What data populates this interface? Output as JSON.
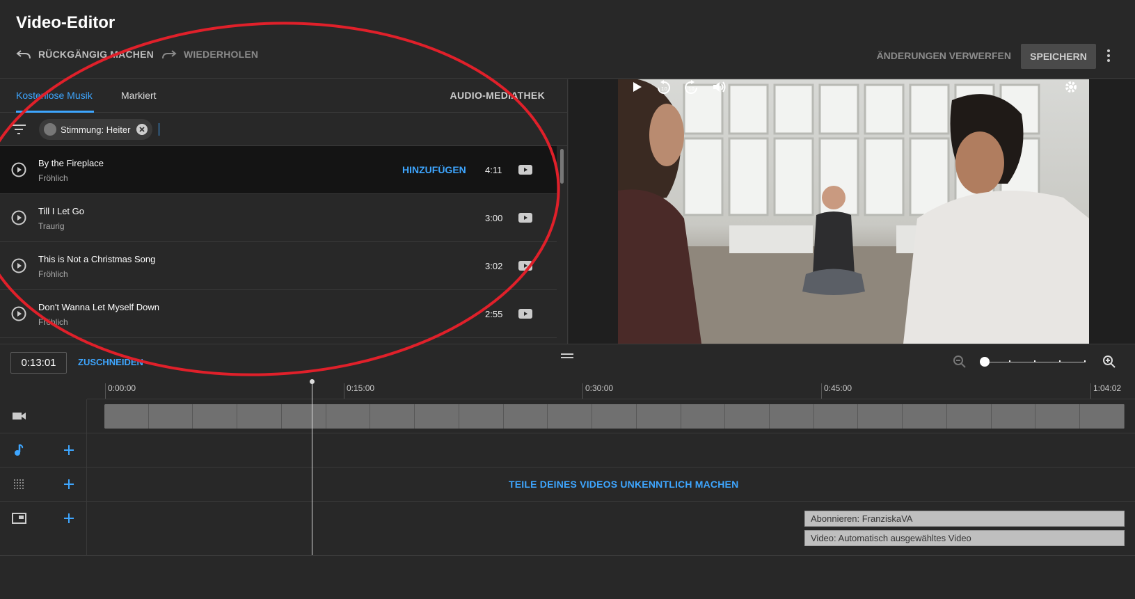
{
  "header": {
    "title": "Video-Editor",
    "undo_label": "RÜCKGÄNGIG MACHEN",
    "redo_label": "WIEDERHOLEN",
    "discard_label": "ÄNDERUNGEN VERWERFEN",
    "save_label": "SPEICHERN"
  },
  "audio_panel": {
    "tabs": [
      {
        "label": "Kostenlose Musik",
        "active": true
      },
      {
        "label": "Markiert",
        "active": false
      }
    ],
    "library_label": "AUDIO-MEDIATHEK",
    "filter_chip": "Stimmung: Heiter",
    "add_label": "HINZUFÜGEN",
    "tracks": [
      {
        "title": "By the Fireplace",
        "mood": "Fröhlich",
        "duration": "4:11"
      },
      {
        "title": "Till I Let Go",
        "mood": "Traurig",
        "duration": "3:00"
      },
      {
        "title": "This is Not a Christmas Song",
        "mood": "Fröhlich",
        "duration": "3:02"
      },
      {
        "title": "Don't Wanna Let Myself Down",
        "mood": "Fröhlich",
        "duration": "2:55"
      }
    ]
  },
  "timeline": {
    "current_time": "0:13:01",
    "trim_label": "ZUSCHNEIDEN",
    "ruler": [
      "0:00:00",
      "0:15:00",
      "0:30:00",
      "0:45:00",
      "1:04:02"
    ],
    "blur_label": "TEILE DEINES VIDEOS UNKENNTLICH MACHEN",
    "endscreen_items": [
      "Abonnieren: FranziskaVA",
      "Video: Automatisch ausgewähltes Video"
    ]
  },
  "colors": {
    "accent": "#3ea6ff",
    "background": "#282828",
    "annotation": "#e0202a"
  }
}
